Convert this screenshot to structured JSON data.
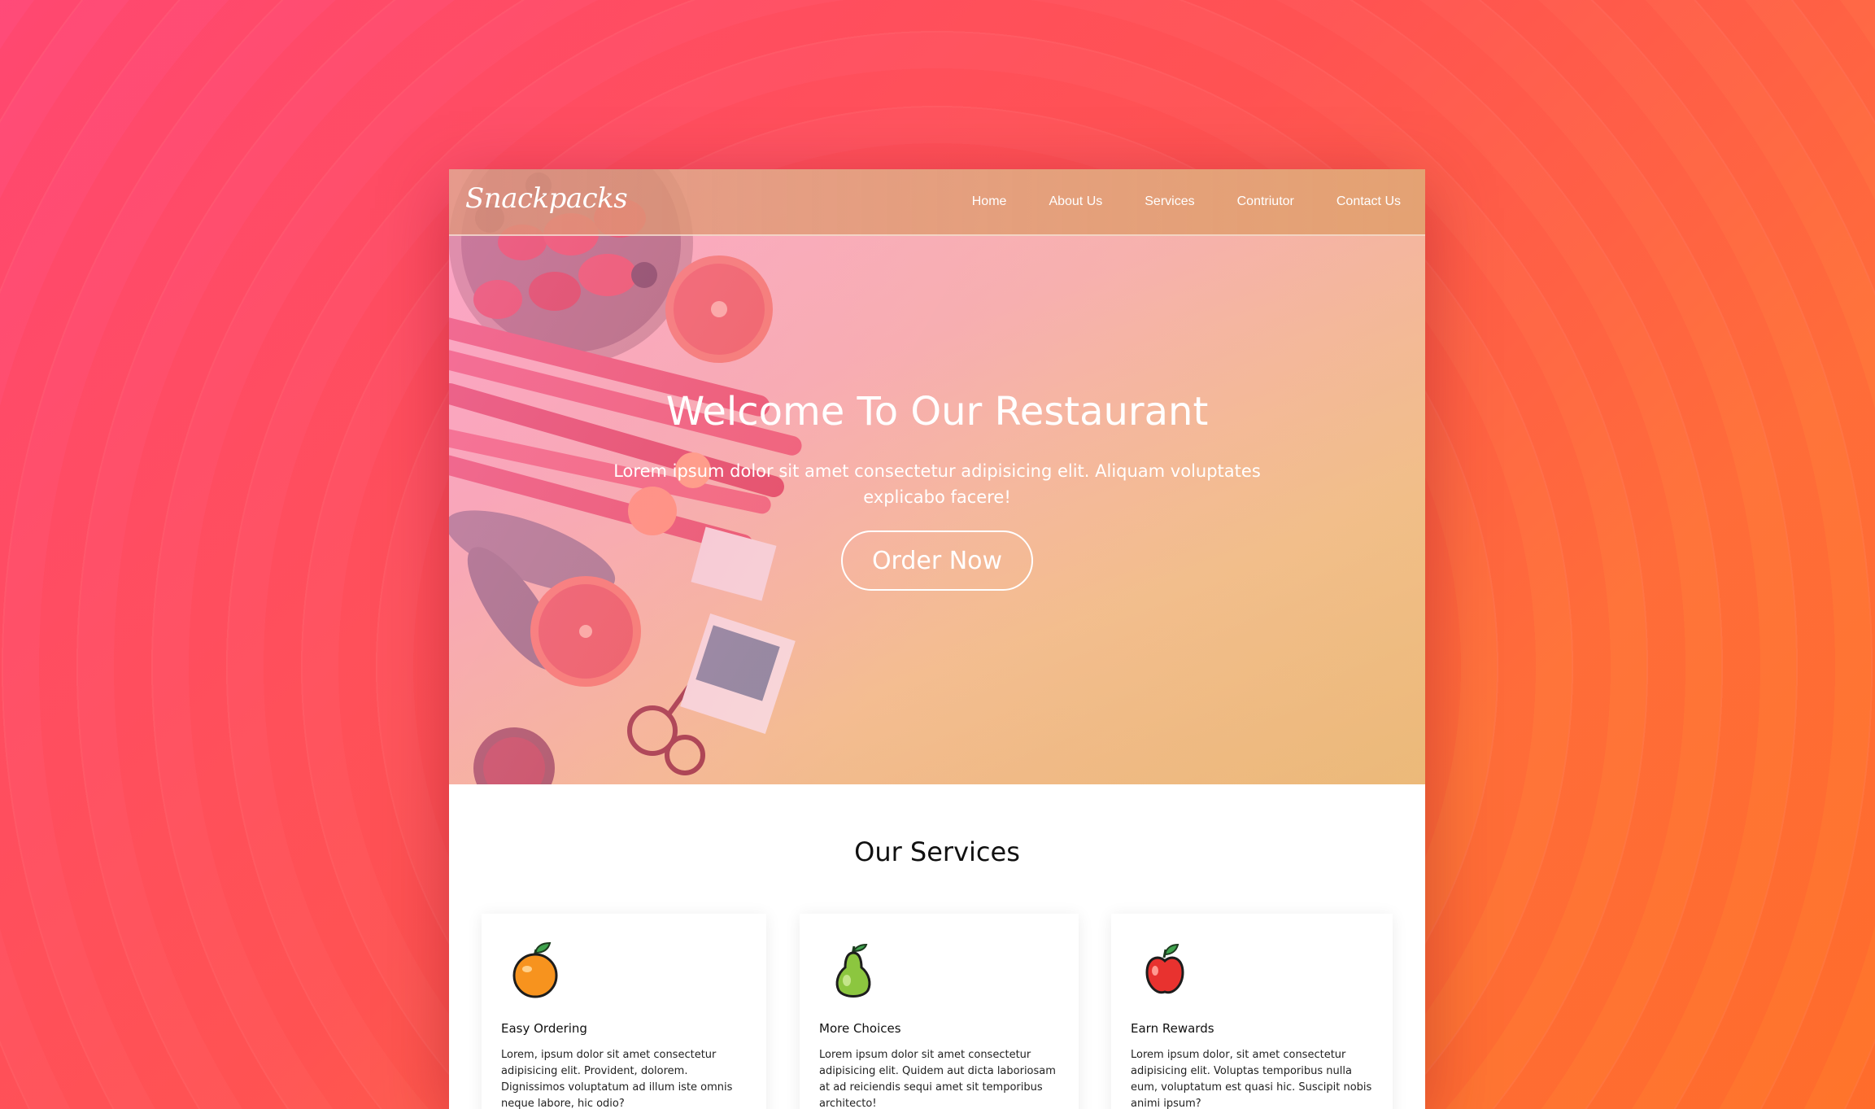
{
  "brand": {
    "logo_text": "Snackpacks"
  },
  "nav": {
    "items": [
      {
        "label": "Home"
      },
      {
        "label": "About Us"
      },
      {
        "label": "Services"
      },
      {
        "label": "Contriutor"
      },
      {
        "label": "Contact Us"
      }
    ]
  },
  "hero": {
    "title": "Welcome To Our Restaurant",
    "subtitle": "Lorem ipsum dolor sit amet consectetur adipisicing elit. Aliquam voluptates explicabo facere!",
    "cta_label": "Order Now"
  },
  "services": {
    "title": "Our Services",
    "cards": [
      {
        "icon": "orange-icon",
        "title": "Easy Ordering",
        "text": "Lorem, ipsum dolor sit amet consectetur adipisicing elit. Provident, dolorem. Dignissimos voluptatum ad illum iste omnis neque labore, hic odio?"
      },
      {
        "icon": "pear-icon",
        "title": "More Choices",
        "text": "Lorem ipsum dolor sit amet consectetur adipisicing elit. Quidem aut dicta laboriosam at ad reiciendis sequi amet sit temporibus architecto!"
      },
      {
        "icon": "apple-icon",
        "title": "Earn Rewards",
        "text": "Lorem ipsum dolor, sit amet consectetur adipisicing elit. Voluptas temporibus nulla eum, voluptatum est quasi hic. Suscipit nobis animi ipsum?"
      }
    ]
  },
  "colors": {
    "background_start": "#ff3d6f",
    "background_end": "#ff6a1a",
    "hero_tint": "#f4b0b5",
    "navbar": "#e2a06e",
    "white": "#ffffff",
    "text_dark": "#111111"
  }
}
